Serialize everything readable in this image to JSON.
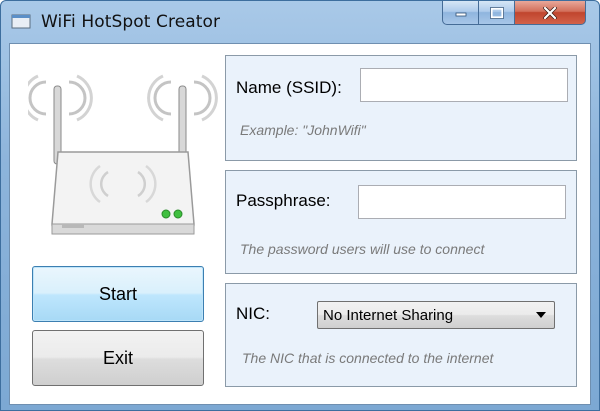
{
  "window": {
    "title": "WiFi HotSpot Creator"
  },
  "icons": {
    "app": "window-app-icon",
    "router": "wifi-router-icon"
  },
  "buttons": {
    "start_label": "Start",
    "exit_label": "Exit"
  },
  "ssid": {
    "label": "Name (SSID):",
    "value": "",
    "hint": "Example: \"JohnWifi\""
  },
  "passphrase": {
    "label": "Passphrase:",
    "value": "",
    "hint": "The password users will use to connect"
  },
  "nic": {
    "label": "NIC:",
    "selected": "No Internet Sharing",
    "hint": "The NIC that is connected to the internet"
  },
  "colors": {
    "group_background": "#eaf2fb",
    "start_button_accent": "#3c7fb1",
    "close_button": "#c0452e"
  }
}
